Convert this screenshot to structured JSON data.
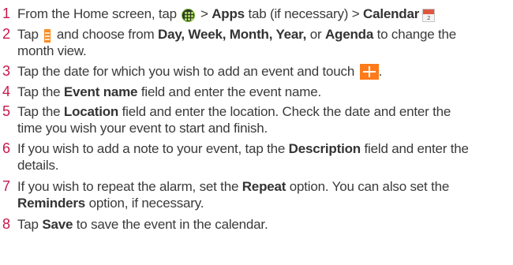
{
  "steps": [
    {
      "num": "1",
      "p1": "From the Home screen, tap ",
      "p2": " > ",
      "b1": "Apps",
      "p3": " tab (if necessary) > ",
      "b2": "Calendar",
      "cal_icon_text": "2"
    },
    {
      "num": "2",
      "p1": "Tap ",
      "p2": " and choose from ",
      "b1": "Day, Week, Month, Year,",
      "p3": " or ",
      "b2": "Agenda",
      "p4": " to change the",
      "p5": "month view."
    },
    {
      "num": "3",
      "p1": "Tap the date for which you wish to add an event and touch ",
      "p2": "."
    },
    {
      "num": "4",
      "p1": "Tap the ",
      "b1": "Event name",
      "p2": " field and enter the event name."
    },
    {
      "num": "5",
      "p1": "Tap the ",
      "b1": "Location",
      "p2": " field and enter the location. Check the date and enter the",
      "p3": "time you wish your event to start and finish."
    },
    {
      "num": "6",
      "p1": "If you wish to add a note to your event, tap the ",
      "b1": "Description",
      "p2": " field and enter the",
      "p3": "details."
    },
    {
      "num": "7",
      "p1": "If you wish to repeat the alarm, set the ",
      "b1": "Repeat",
      "p2": " option. You can also set the",
      "b2": "Reminders",
      "p3": " option, if necessary."
    },
    {
      "num": "8",
      "p1": "Tap ",
      "b1": "Save",
      "p2": " to save the event in the calendar."
    }
  ],
  "icons": {
    "apps": "apps-grid-icon",
    "calendar": "calendar-app-icon",
    "menu": "menu-icon",
    "add": "add-event-icon"
  },
  "colors": {
    "step_number": "#c8174b",
    "text": "#3a3a3a",
    "accent_orange": "#ff7a1a"
  }
}
